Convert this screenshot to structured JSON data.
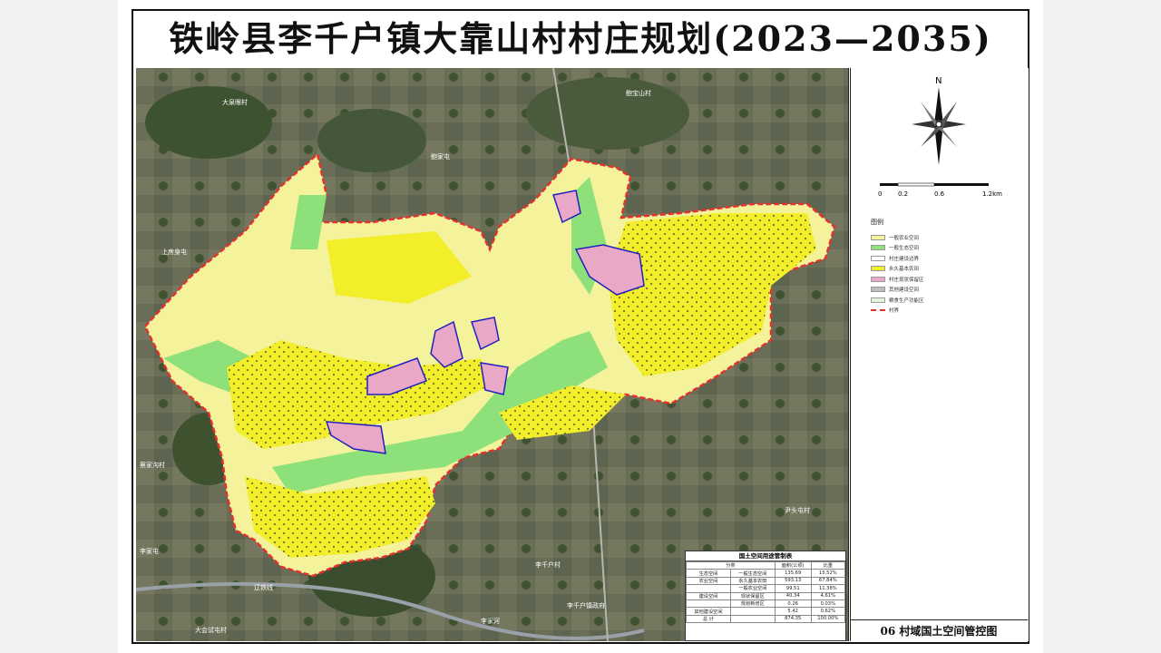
{
  "title": "铁岭县李千户镇大靠山村村庄规划(2023—2035)",
  "north_label": "N",
  "scale": {
    "ticks": [
      "0",
      "0.2",
      "0.6",
      "1.2km"
    ]
  },
  "legend": {
    "title": "图例",
    "items": [
      {
        "label": "一般农业空间",
        "color": "#f4f29a"
      },
      {
        "label": "一般生态空间",
        "color": "#8de07a"
      },
      {
        "label": "村庄建设边界",
        "color": "#ffffff"
      },
      {
        "label": "永久基本农田",
        "color": "#f2ee2a"
      },
      {
        "label": "村庄现状保留区",
        "color": "#e9a9c6"
      },
      {
        "label": "其他建设空间",
        "color": "#bdbdbd"
      },
      {
        "label": "粮食生产功能区",
        "color": "#e4f5dc"
      },
      {
        "label": "村界",
        "color": "#e53030"
      }
    ]
  },
  "caption": "06 村域国土空间管控图",
  "place_labels": [
    "大泉眼村",
    "鲍宝山村",
    "鲍家屯",
    "上房身屯",
    "蔡家沟村",
    "尹头屯村",
    "李家屯",
    "李千户村",
    "李千户镇政府",
    "辽铁线",
    "大会试屯村",
    "李家河"
  ],
  "control_table": {
    "title": "国土空间用途管制表",
    "headers": [
      "分类",
      "",
      "面积(公顷)",
      "比重"
    ],
    "rows": [
      {
        "group": "生态空间",
        "type": "一般生态空间",
        "area": "135.69",
        "share": "15.52%"
      },
      {
        "group": "农业空间",
        "type": "永久基本农田",
        "area": "593.13",
        "share": "67.84%"
      },
      {
        "group": "",
        "type": "一般农业空间",
        "area": "99.51",
        "share": "11.38%"
      },
      {
        "group": "建设空间",
        "type": "现状保留区",
        "area": "40.34",
        "share": "4.61%"
      },
      {
        "group": "",
        "type": "规划新增区",
        "area": "0.26",
        "share": "0.03%"
      },
      {
        "group": "其他建设空间",
        "type": "",
        "area": "5.42",
        "share": "0.62%"
      },
      {
        "group": "总 计",
        "type": "",
        "area": "874.35",
        "share": "100.00%"
      }
    ]
  }
}
